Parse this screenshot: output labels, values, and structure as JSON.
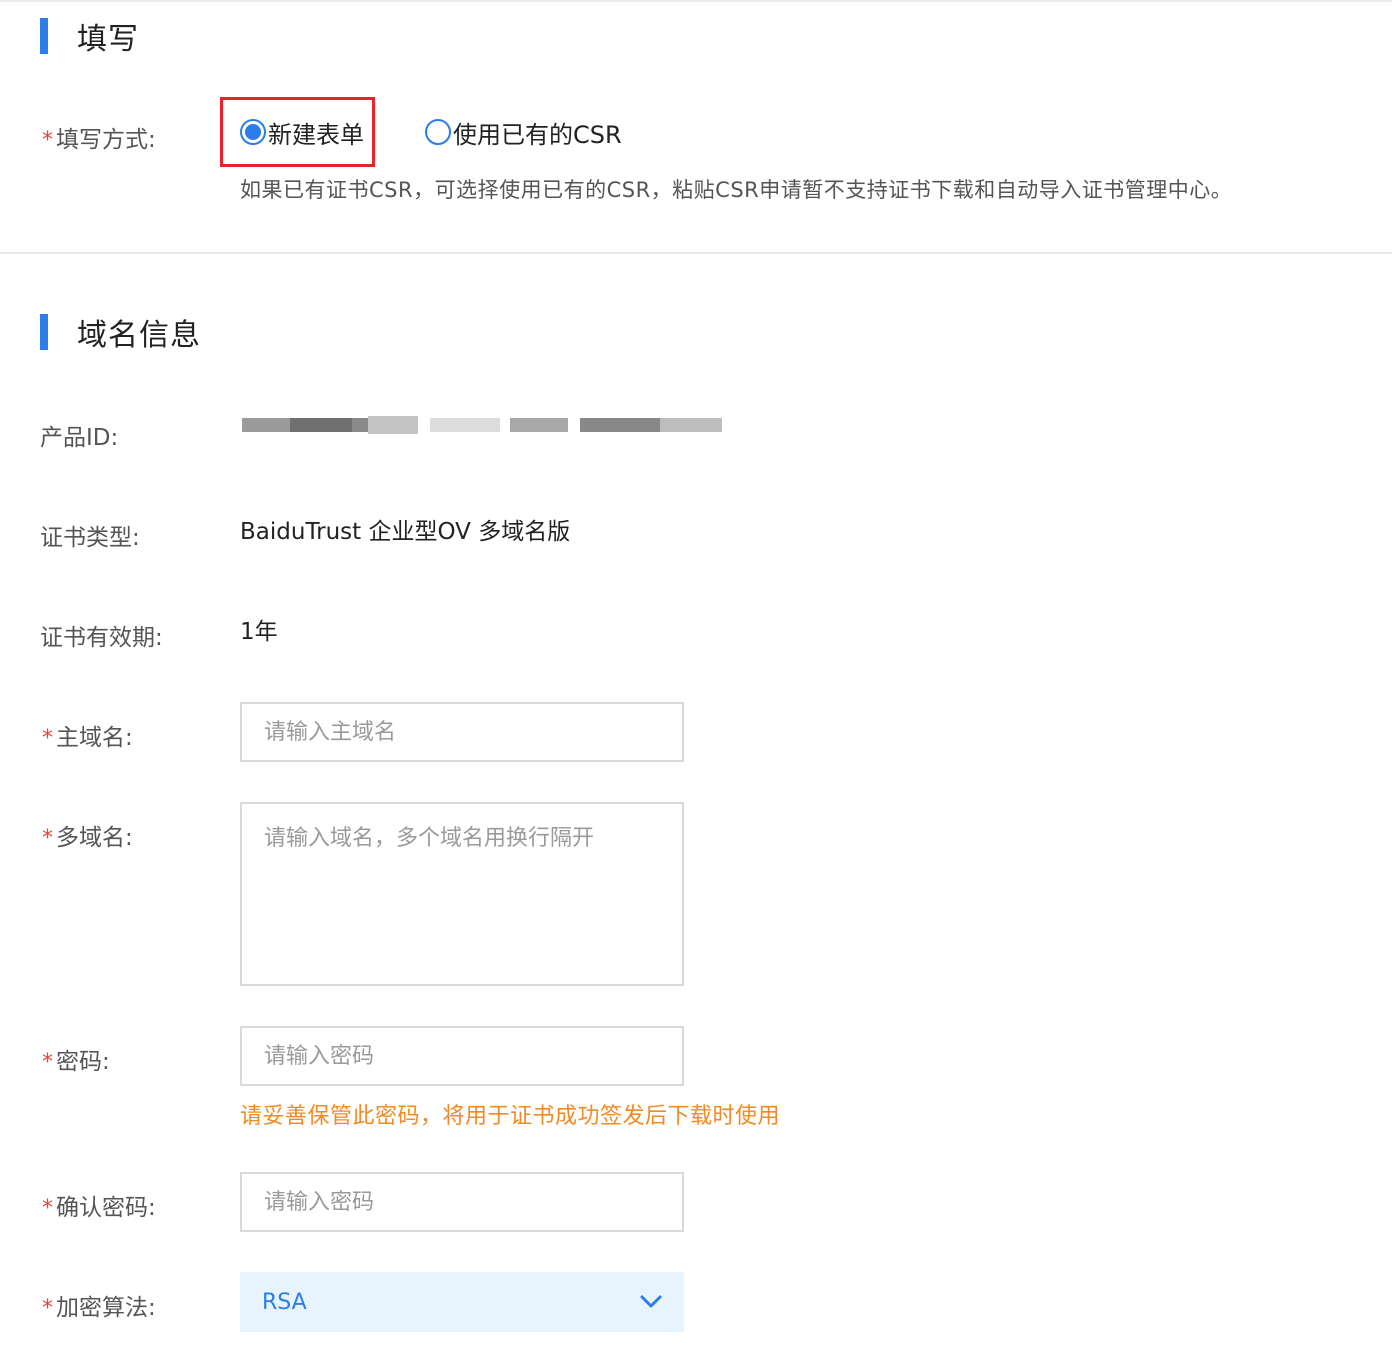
{
  "fill_section": {
    "title": "填写",
    "method_label": "填写方式:",
    "options": [
      "新建表单",
      "使用已有的CSR"
    ],
    "selected_option": "新建表单",
    "hint": "如果已有证书CSR，可选择使用已有的CSR，粘贴CSR申请暂不支持证书下载和自动导入证书管理中心。"
  },
  "domain_section": {
    "title": "域名信息",
    "product_id_label": "产品ID:",
    "cert_type_label": "证书类型:",
    "cert_type_value": "BaiduTrust 企业型OV 多域名版",
    "validity_label": "证书有效期:",
    "validity_value": "1年",
    "main_domain_label": "主域名:",
    "main_domain_placeholder": "请输入主域名",
    "multi_domain_label": "多域名:",
    "multi_domain_placeholder": "请输入域名，多个域名用换行隔开",
    "password_label": "密码:",
    "password_placeholder": "请输入密码",
    "password_warning": "请妥善保管此密码，将用于证书成功签发后下载时使用",
    "confirm_password_label": "确认密码:",
    "confirm_password_placeholder": "请输入密码",
    "algorithm_label": "加密算法:",
    "algorithm_value": "RSA"
  },
  "required_mark": "*",
  "colors": {
    "accent": "#2b7de9",
    "required": "#e6473c",
    "warning": "#f08a24",
    "highlight_box": "#e8242c",
    "select_bg": "#e8f4fd"
  },
  "icons": {
    "select_arrow": "chevron-down-icon"
  }
}
